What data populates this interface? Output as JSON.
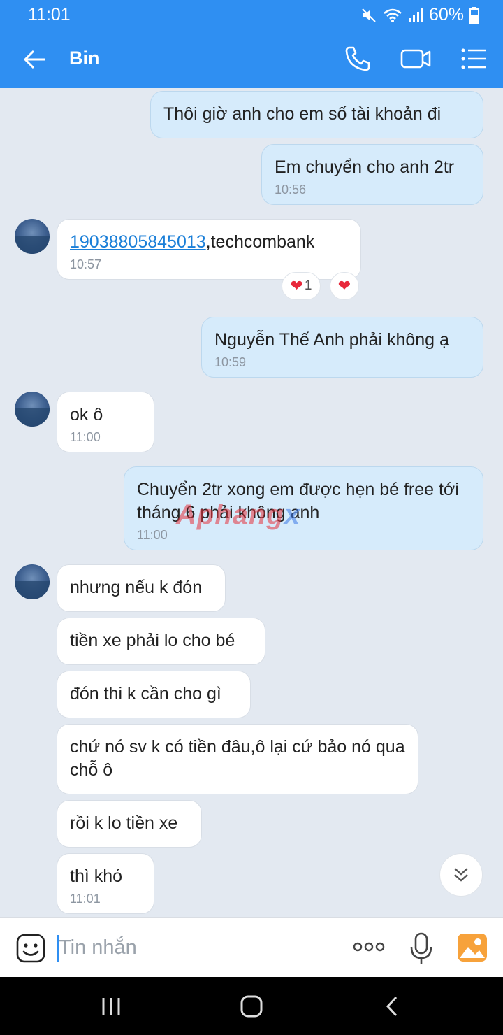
{
  "status_bar": {
    "time": "11:01",
    "battery": "60%"
  },
  "header": {
    "title": "Bin"
  },
  "messages": [
    {
      "dir": "out",
      "text": "Thôi giờ anh cho em số tài khoản đi",
      "time": ""
    },
    {
      "dir": "out",
      "text": "Em chuyển cho anh 2tr",
      "time": "10:56"
    },
    {
      "dir": "in",
      "link": "19038805845013",
      "text": ",techcombank",
      "time": "10:57"
    },
    {
      "dir": "out",
      "text": "Nguyễn Thế Anh phải không ạ",
      "time": "10:59"
    },
    {
      "dir": "in",
      "text": "ok ô",
      "time": "11:00"
    },
    {
      "dir": "out",
      "text": "Chuyển 2tr xong em được hẹn bé free tới tháng 6 phải không anh",
      "time": "11:00"
    },
    {
      "dir": "in",
      "text": "nhưng nếu k đón",
      "time": ""
    },
    {
      "dir": "in",
      "text": "tiền xe phải lo cho bé",
      "time": ""
    },
    {
      "dir": "in",
      "text": "đón thi k cần cho gì",
      "time": ""
    },
    {
      "dir": "in",
      "text": "chứ nó sv k có tiền đâu,ô lại cứ bảo nó qua chỗ ô",
      "time": ""
    },
    {
      "dir": "in",
      "text": "rồi k lo tiền xe",
      "time": ""
    },
    {
      "dir": "in",
      "text": "thì khó",
      "time": "11:01"
    }
  ],
  "reactions": {
    "count": "1"
  },
  "watermark": {
    "main": "Aphang",
    "suffix": "x"
  },
  "composer": {
    "placeholder": "Tin nhắn"
  },
  "colors": {
    "header": "#2f8ff2",
    "outgoing_bubble": "#d6ebfb",
    "incoming_bubble": "#ffffff",
    "background": "#e3e9f1"
  }
}
